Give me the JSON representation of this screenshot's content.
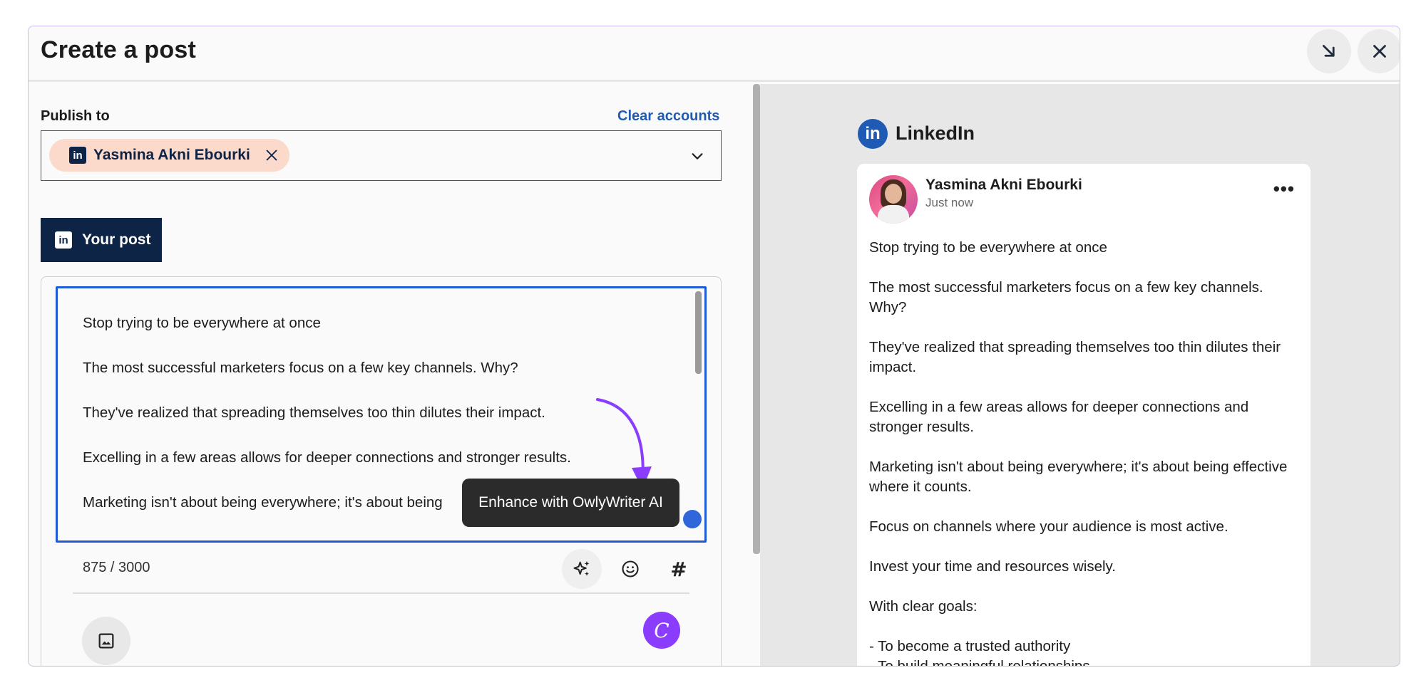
{
  "modal": {
    "title": "Create a post",
    "minimize_icon": "arrow-down-right-icon",
    "close_icon": "close-icon"
  },
  "publish": {
    "label": "Publish to",
    "clear_link": "Clear accounts",
    "account_chip": {
      "network": "linkedin",
      "name": "Yasmina Akni Ebourki"
    }
  },
  "tab": {
    "label": "Your post",
    "icon": "linkedin-icon"
  },
  "editor": {
    "lines": [
      "Stop trying to be everywhere at once",
      "The most successful marketers focus on a few key channels. Why?",
      "They've realized that spreading themselves too thin dilutes their impact.",
      "Excelling in a few areas allows for deeper connections and stronger results.",
      "Marketing isn't about being everywhere; it's about being"
    ],
    "tooltip": "Enhance with OwlyWriter AI",
    "counter": "875 / 3000",
    "tools": [
      "ai-sparkle-icon",
      "emoji-icon",
      "hashtag-icon"
    ],
    "hashtag_glyph": "#",
    "canva_glyph": "C"
  },
  "preview": {
    "network_badge": "in",
    "network_label": "LinkedIn",
    "author": "Yasmina Akni Ebourki",
    "time": "Just now",
    "more": "•••",
    "paragraphs": [
      "Stop trying to be everywhere at once",
      "The most successful marketers focus on a few key channels. Why?",
      "They've realized that spreading themselves too thin dilutes their impact.",
      "Excelling in a few areas allows for deeper connections and stronger results.",
      "Marketing isn't about being everywhere; it's about being effective where it counts.",
      "Focus on channels where your audience is most active.",
      "Invest your time and resources wisely.",
      "With clear goals:",
      "- To become a trusted authority",
      "- To build meaningful relationships"
    ]
  },
  "colors": {
    "accent_blue": "#1c5ad6",
    "linkedin_navy": "#0d2446",
    "chip_bg": "#fbd9cb",
    "ai_purple": "#8b3dff"
  }
}
